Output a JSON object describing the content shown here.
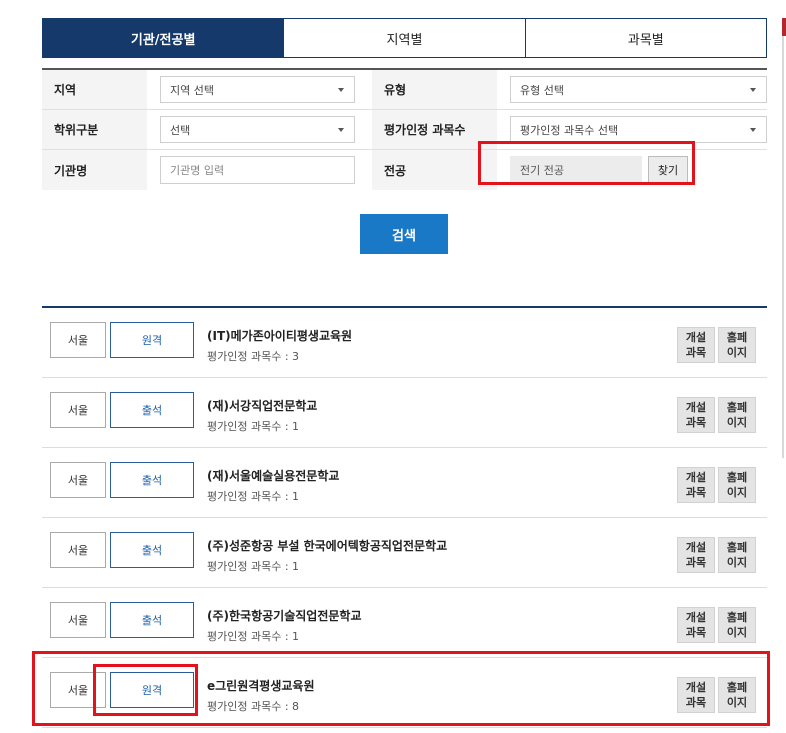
{
  "tabs": [
    {
      "label": "기관/전공별",
      "active": true
    },
    {
      "label": "지역별",
      "active": false
    },
    {
      "label": "과목별",
      "active": false
    }
  ],
  "filters": {
    "region": {
      "label": "지역",
      "value": "지역 선택"
    },
    "type": {
      "label": "유형",
      "value": "유형 선택"
    },
    "degree": {
      "label": "학위구분",
      "value": "선택"
    },
    "credit_count": {
      "label": "평가인정 과목수",
      "value": "평가인정 과목수 선택"
    },
    "institution": {
      "label": "기관명",
      "placeholder": "기관명 입력"
    },
    "major": {
      "label": "전공",
      "value": "전기 전공",
      "find_label": "찾기"
    }
  },
  "search_label": "검색",
  "results": [
    {
      "region": "서울",
      "mode": "원격",
      "name": "(IT)메가존아이티평생교육원",
      "count_label": "평가인정 과목수 : 3",
      "open_label": "개설\n과목",
      "home_label": "홈페\n이지"
    },
    {
      "region": "서울",
      "mode": "출석",
      "name": "(재)서강직업전문학교",
      "count_label": "평가인정 과목수 : 1",
      "open_label": "개설\n과목",
      "home_label": "홈페\n이지"
    },
    {
      "region": "서울",
      "mode": "출석",
      "name": "(재)서울예술실용전문학교",
      "count_label": "평가인정 과목수 : 1",
      "open_label": "개설\n과목",
      "home_label": "홈페\n이지"
    },
    {
      "region": "서울",
      "mode": "출석",
      "name": "(주)성준항공 부설 한국에어텍항공직업전문학교",
      "count_label": "평가인정 과목수 : 1",
      "open_label": "개설\n과목",
      "home_label": "홈페\n이지"
    },
    {
      "region": "서울",
      "mode": "출석",
      "name": "(주)한국항공기술직업전문학교",
      "count_label": "평가인정 과목수 : 1",
      "open_label": "개설\n과목",
      "home_label": "홈페\n이지"
    },
    {
      "region": "서울",
      "mode": "원격",
      "name": "e그린원격평생교육원",
      "count_label": "평가인정 과목수 : 8",
      "open_label": "개설\n과목",
      "home_label": "홈페\n이지"
    }
  ],
  "colors": {
    "primary": "#14396a",
    "button": "#1a79c7",
    "highlight": "#e2131b"
  }
}
